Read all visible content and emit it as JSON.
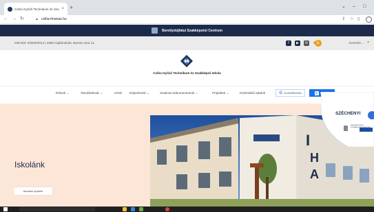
{
  "browser": {
    "tab_title": "Csiha Győző Technikum és Szakk",
    "tab_close": "×",
    "new_tab": "+",
    "url": "csiha-hnanas.hu",
    "window_controls": [
      "⌄",
      "–",
      "□"
    ]
  },
  "site": {
    "banner_title": "Berettyóújfalui Szakképzési Centrum",
    "info_text": "OM kód: 203030/014 | 4080 Hajdúnánás, Baross utca 11.",
    "search_label": "Keresés ...",
    "school_name": "Csiha Győző Technikum és Szakképző Iskola",
    "nav": {
      "items": [
        {
          "label": "Rólunk",
          "has_dropdown": true
        },
        {
          "label": "Tanulóinknak",
          "has_dropdown": true
        },
        {
          "label": "Hírek",
          "has_dropdown": false
        },
        {
          "label": "Képzéseink",
          "has_dropdown": true
        },
        {
          "label": "Szakmai dokumentumok",
          "has_dropdown": true
        },
        {
          "label": "Projektek",
          "has_dropdown": true
        },
        {
          "label": "Közérdekű adatok",
          "has_dropdown": false
        }
      ],
      "dropdown_glyph": "⌄",
      "classroom_label": "CLASSROOM",
      "kreta_label": "KRÉTA"
    },
    "hero": {
      "title": "Iskolánk",
      "subtitle": "-",
      "button_label": "Iskolánk épülete"
    },
    "szechenyi": {
      "title": "SZÉCHENYI",
      "caption": "MAGYARORSZÁG KORMÁNYA EURÓPAI UNIÓ"
    }
  },
  "colors": {
    "navy": "#1c2b4a",
    "accent_blue": "#1a73e8",
    "hero_bg": "#fce6d8",
    "accessibility_orange": "#f39c12"
  },
  "icons": [
    "back-icon",
    "forward-icon",
    "reload-icon",
    "lock-icon",
    "share-icon",
    "star-icon",
    "sidebar-icon",
    "profile-icon",
    "facebook-icon",
    "youtube-icon",
    "mail-icon",
    "phone-icon",
    "accessibility-icon",
    "search-icon"
  ]
}
